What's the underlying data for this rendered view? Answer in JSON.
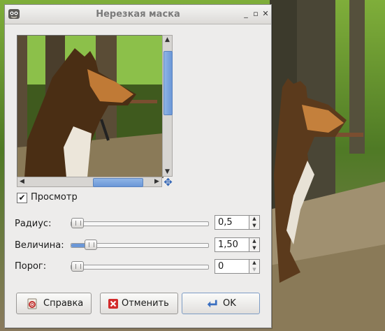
{
  "window": {
    "title": "Нерезкая маска",
    "app_icon": "gimp-icon",
    "controls": [
      "minimize-icon",
      "maximize-icon",
      "close-icon"
    ]
  },
  "preview": {
    "toggle_label": "Просмотр",
    "toggle_checked": true,
    "nav_icon": "move-navigate-icon"
  },
  "params": [
    {
      "name": "radius",
      "label": "Радиус:",
      "value": "0,5",
      "level": 0.0
    },
    {
      "name": "amount",
      "label": "Величина:",
      "value": "1,50",
      "level": 0.1
    },
    {
      "name": "threshold",
      "label": "Порог:",
      "value": "0",
      "level": 0.0
    }
  ],
  "buttons": [
    {
      "name": "help",
      "label": "Справка",
      "icon": "help-icon"
    },
    {
      "name": "cancel",
      "label": "Отменить",
      "icon": "cancel-icon"
    },
    {
      "name": "ok",
      "label": "OK",
      "icon": "ok-return-icon"
    }
  ],
  "colors": {
    "accent": "#6b97d7",
    "dialog_bg": "#edeceb",
    "cancel_red": "#d22b2b"
  }
}
